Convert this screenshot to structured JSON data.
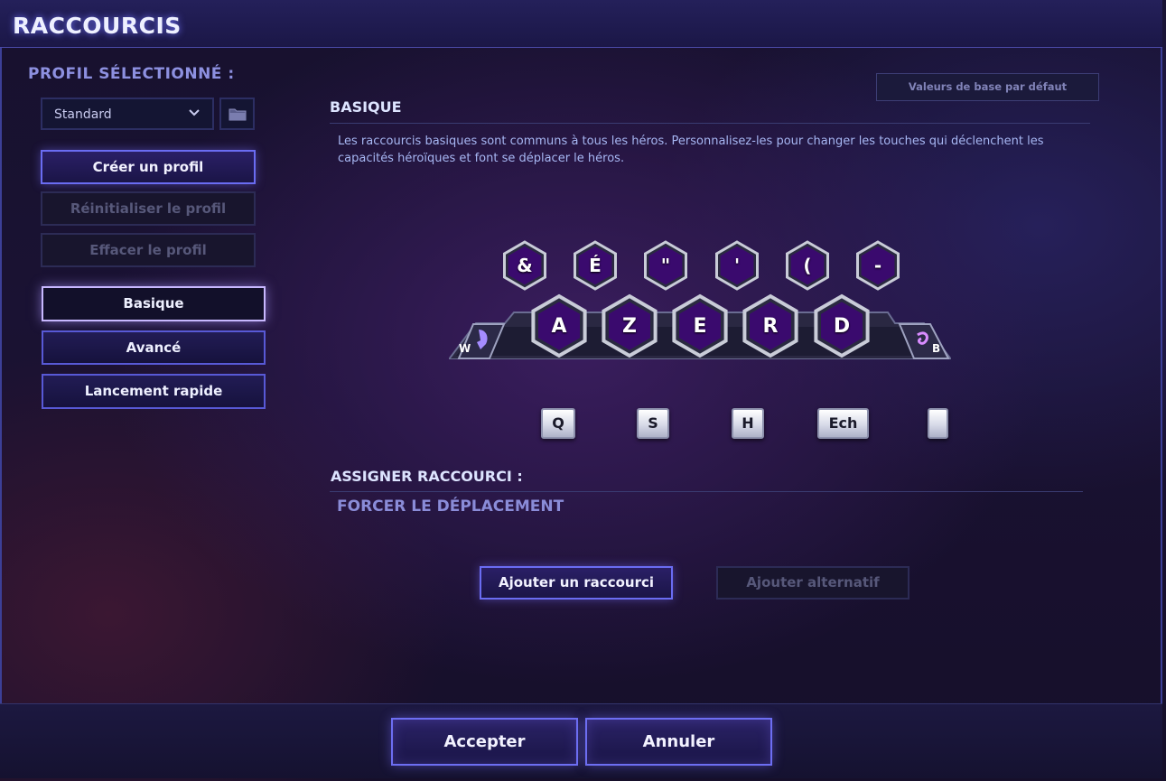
{
  "window": {
    "title": "RACCOURCIS"
  },
  "sidebar": {
    "profile_label": "PROFIL SÉLECTIONNÉ :",
    "profile_select": "Standard",
    "create_profile": "Créer un profil",
    "reset_profile": "Réinitialiser le profil",
    "delete_profile": "Effacer le profil",
    "tabs": [
      {
        "label": "Basique",
        "active": true
      },
      {
        "label": "Avancé",
        "active": false
      },
      {
        "label": "Lancement rapide",
        "active": false
      }
    ]
  },
  "main": {
    "default_values_button": "Valeurs de base par défaut",
    "section_title": "BASIQUE",
    "description": "Les raccourcis basiques sont communs à tous les héros. Personnalisez-les pour changer les touches qui déclenchent les capacités héroïques et font se déplacer le héros.",
    "top_keys": [
      "&",
      "É",
      "\"",
      "'",
      "(",
      "-"
    ],
    "ability_keys": [
      "A",
      "Z",
      "E",
      "R",
      "D"
    ],
    "mount_key": "W",
    "hearth_key": "B",
    "bottom_keys": [
      "Q",
      "S",
      "H",
      "Ech",
      ""
    ],
    "assign_title": "ASSIGNER RACCOURCI :",
    "assign_value": "FORCER LE DÉPLACEMENT",
    "add_shortcut": "Ajouter un raccourci",
    "add_alternate": "Ajouter alternatif"
  },
  "footer": {
    "accept": "Accepter",
    "cancel": "Annuler"
  },
  "colors": {
    "accent": "#6a6cf2",
    "hex_fill": "#3a0a6e",
    "hex_border": "#c9ccd8"
  },
  "icons": {
    "dropdown": "chevron-down-icon",
    "folder": "folder-icon",
    "mount": "horse-head-icon",
    "hearth": "hearthstone-swirl-icon"
  }
}
